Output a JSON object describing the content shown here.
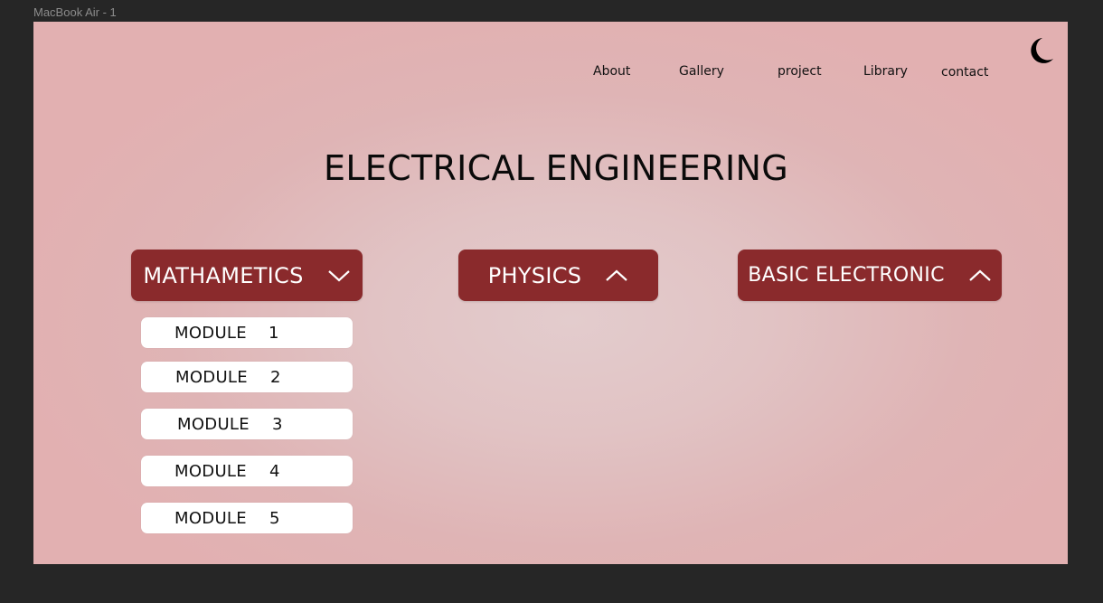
{
  "frame": {
    "label": "MacBook Air - 1"
  },
  "nav": {
    "items": [
      "About",
      "Gallery",
      "project",
      "Library",
      "contact"
    ],
    "theme_toggle_icon": "moon-icon"
  },
  "page": {
    "title": "ELECTRICAL ENGINEERING"
  },
  "subjects": [
    {
      "label": "MATHAMETICS",
      "icon": "chevron-down-icon",
      "expanded": true
    },
    {
      "label": "PHYSICS",
      "icon": "chevron-up-icon",
      "expanded": false
    },
    {
      "label": "BASIC ELECTRONIC",
      "icon": "chevron-up-icon",
      "expanded": false
    }
  ],
  "modules": [
    {
      "label": "MODULE",
      "number": "1"
    },
    {
      "label": "MODULE",
      "number": "2"
    },
    {
      "label": "MODULE",
      "number": "3"
    },
    {
      "label": "MODULE",
      "number": "4"
    },
    {
      "label": "MODULE",
      "number": "5"
    }
  ],
  "colors": {
    "app_background": "#262626",
    "accent": "#8a2a2c",
    "module_background": "#ffffff",
    "text": "#111111"
  }
}
